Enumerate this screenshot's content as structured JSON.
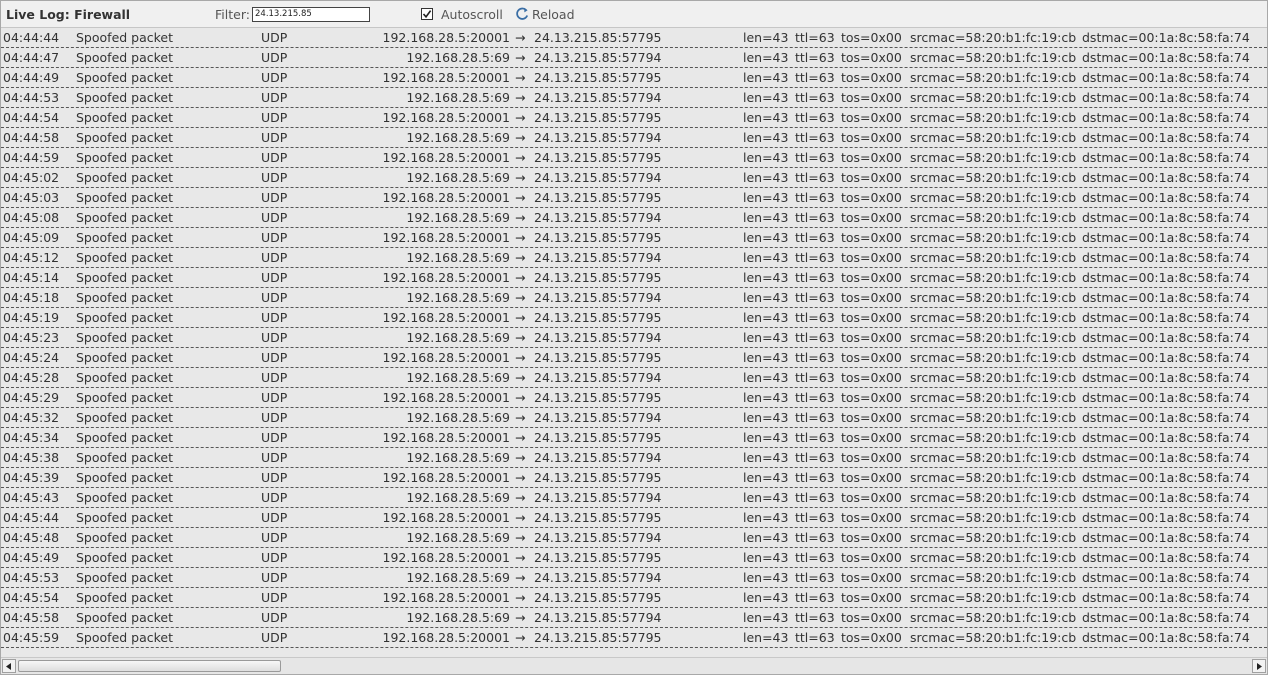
{
  "toolbar": {
    "title": "Live Log: Firewall",
    "filter_label": "Filter:",
    "filter_value": "24.13.215.85",
    "autoscroll_label": "Autoscroll",
    "autoscroll_checked": true,
    "reload_label": "Reload"
  },
  "colors": {
    "reload_icon": "#3a6ea5",
    "row_divider": "#555555"
  },
  "log": {
    "rows": [
      {
        "time": "04:44:44",
        "message": "Spoofed packet",
        "protocol": "UDP",
        "src": "192.168.28.5:20001",
        "arrow": "→",
        "dst": "24.13.215.85:57795",
        "len": "len=43",
        "ttl": "ttl=63",
        "tos": "tos=0x00",
        "srcmac": "srcmac=58:20:b1:fc:19:cb",
        "dstmac": "dstmac=00:1a:8c:58:fa:74"
      },
      {
        "time": "04:44:47",
        "message": "Spoofed packet",
        "protocol": "UDP",
        "src": "192.168.28.5:69",
        "arrow": "→",
        "dst": "24.13.215.85:57794",
        "len": "len=43",
        "ttl": "ttl=63",
        "tos": "tos=0x00",
        "srcmac": "srcmac=58:20:b1:fc:19:cb",
        "dstmac": "dstmac=00:1a:8c:58:fa:74"
      },
      {
        "time": "04:44:49",
        "message": "Spoofed packet",
        "protocol": "UDP",
        "src": "192.168.28.5:20001",
        "arrow": "→",
        "dst": "24.13.215.85:57795",
        "len": "len=43",
        "ttl": "ttl=63",
        "tos": "tos=0x00",
        "srcmac": "srcmac=58:20:b1:fc:19:cb",
        "dstmac": "dstmac=00:1a:8c:58:fa:74"
      },
      {
        "time": "04:44:53",
        "message": "Spoofed packet",
        "protocol": "UDP",
        "src": "192.168.28.5:69",
        "arrow": "→",
        "dst": "24.13.215.85:57794",
        "len": "len=43",
        "ttl": "ttl=63",
        "tos": "tos=0x00",
        "srcmac": "srcmac=58:20:b1:fc:19:cb",
        "dstmac": "dstmac=00:1a:8c:58:fa:74"
      },
      {
        "time": "04:44:54",
        "message": "Spoofed packet",
        "protocol": "UDP",
        "src": "192.168.28.5:20001",
        "arrow": "→",
        "dst": "24.13.215.85:57795",
        "len": "len=43",
        "ttl": "ttl=63",
        "tos": "tos=0x00",
        "srcmac": "srcmac=58:20:b1:fc:19:cb",
        "dstmac": "dstmac=00:1a:8c:58:fa:74"
      },
      {
        "time": "04:44:58",
        "message": "Spoofed packet",
        "protocol": "UDP",
        "src": "192.168.28.5:69",
        "arrow": "→",
        "dst": "24.13.215.85:57794",
        "len": "len=43",
        "ttl": "ttl=63",
        "tos": "tos=0x00",
        "srcmac": "srcmac=58:20:b1:fc:19:cb",
        "dstmac": "dstmac=00:1a:8c:58:fa:74"
      },
      {
        "time": "04:44:59",
        "message": "Spoofed packet",
        "protocol": "UDP",
        "src": "192.168.28.5:20001",
        "arrow": "→",
        "dst": "24.13.215.85:57795",
        "len": "len=43",
        "ttl": "ttl=63",
        "tos": "tos=0x00",
        "srcmac": "srcmac=58:20:b1:fc:19:cb",
        "dstmac": "dstmac=00:1a:8c:58:fa:74"
      },
      {
        "time": "04:45:02",
        "message": "Spoofed packet",
        "protocol": "UDP",
        "src": "192.168.28.5:69",
        "arrow": "→",
        "dst": "24.13.215.85:57794",
        "len": "len=43",
        "ttl": "ttl=63",
        "tos": "tos=0x00",
        "srcmac": "srcmac=58:20:b1:fc:19:cb",
        "dstmac": "dstmac=00:1a:8c:58:fa:74"
      },
      {
        "time": "04:45:03",
        "message": "Spoofed packet",
        "protocol": "UDP",
        "src": "192.168.28.5:20001",
        "arrow": "→",
        "dst": "24.13.215.85:57795",
        "len": "len=43",
        "ttl": "ttl=63",
        "tos": "tos=0x00",
        "srcmac": "srcmac=58:20:b1:fc:19:cb",
        "dstmac": "dstmac=00:1a:8c:58:fa:74"
      },
      {
        "time": "04:45:08",
        "message": "Spoofed packet",
        "protocol": "UDP",
        "src": "192.168.28.5:69",
        "arrow": "→",
        "dst": "24.13.215.85:57794",
        "len": "len=43",
        "ttl": "ttl=63",
        "tos": "tos=0x00",
        "srcmac": "srcmac=58:20:b1:fc:19:cb",
        "dstmac": "dstmac=00:1a:8c:58:fa:74"
      },
      {
        "time": "04:45:09",
        "message": "Spoofed packet",
        "protocol": "UDP",
        "src": "192.168.28.5:20001",
        "arrow": "→",
        "dst": "24.13.215.85:57795",
        "len": "len=43",
        "ttl": "ttl=63",
        "tos": "tos=0x00",
        "srcmac": "srcmac=58:20:b1:fc:19:cb",
        "dstmac": "dstmac=00:1a:8c:58:fa:74"
      },
      {
        "time": "04:45:12",
        "message": "Spoofed packet",
        "protocol": "UDP",
        "src": "192.168.28.5:69",
        "arrow": "→",
        "dst": "24.13.215.85:57794",
        "len": "len=43",
        "ttl": "ttl=63",
        "tos": "tos=0x00",
        "srcmac": "srcmac=58:20:b1:fc:19:cb",
        "dstmac": "dstmac=00:1a:8c:58:fa:74"
      },
      {
        "time": "04:45:14",
        "message": "Spoofed packet",
        "protocol": "UDP",
        "src": "192.168.28.5:20001",
        "arrow": "→",
        "dst": "24.13.215.85:57795",
        "len": "len=43",
        "ttl": "ttl=63",
        "tos": "tos=0x00",
        "srcmac": "srcmac=58:20:b1:fc:19:cb",
        "dstmac": "dstmac=00:1a:8c:58:fa:74"
      },
      {
        "time": "04:45:18",
        "message": "Spoofed packet",
        "protocol": "UDP",
        "src": "192.168.28.5:69",
        "arrow": "→",
        "dst": "24.13.215.85:57794",
        "len": "len=43",
        "ttl": "ttl=63",
        "tos": "tos=0x00",
        "srcmac": "srcmac=58:20:b1:fc:19:cb",
        "dstmac": "dstmac=00:1a:8c:58:fa:74"
      },
      {
        "time": "04:45:19",
        "message": "Spoofed packet",
        "protocol": "UDP",
        "src": "192.168.28.5:20001",
        "arrow": "→",
        "dst": "24.13.215.85:57795",
        "len": "len=43",
        "ttl": "ttl=63",
        "tos": "tos=0x00",
        "srcmac": "srcmac=58:20:b1:fc:19:cb",
        "dstmac": "dstmac=00:1a:8c:58:fa:74"
      },
      {
        "time": "04:45:23",
        "message": "Spoofed packet",
        "protocol": "UDP",
        "src": "192.168.28.5:69",
        "arrow": "→",
        "dst": "24.13.215.85:57794",
        "len": "len=43",
        "ttl": "ttl=63",
        "tos": "tos=0x00",
        "srcmac": "srcmac=58:20:b1:fc:19:cb",
        "dstmac": "dstmac=00:1a:8c:58:fa:74"
      },
      {
        "time": "04:45:24",
        "message": "Spoofed packet",
        "protocol": "UDP",
        "src": "192.168.28.5:20001",
        "arrow": "→",
        "dst": "24.13.215.85:57795",
        "len": "len=43",
        "ttl": "ttl=63",
        "tos": "tos=0x00",
        "srcmac": "srcmac=58:20:b1:fc:19:cb",
        "dstmac": "dstmac=00:1a:8c:58:fa:74"
      },
      {
        "time": "04:45:28",
        "message": "Spoofed packet",
        "protocol": "UDP",
        "src": "192.168.28.5:69",
        "arrow": "→",
        "dst": "24.13.215.85:57794",
        "len": "len=43",
        "ttl": "ttl=63",
        "tos": "tos=0x00",
        "srcmac": "srcmac=58:20:b1:fc:19:cb",
        "dstmac": "dstmac=00:1a:8c:58:fa:74"
      },
      {
        "time": "04:45:29",
        "message": "Spoofed packet",
        "protocol": "UDP",
        "src": "192.168.28.5:20001",
        "arrow": "→",
        "dst": "24.13.215.85:57795",
        "len": "len=43",
        "ttl": "ttl=63",
        "tos": "tos=0x00",
        "srcmac": "srcmac=58:20:b1:fc:19:cb",
        "dstmac": "dstmac=00:1a:8c:58:fa:74"
      },
      {
        "time": "04:45:32",
        "message": "Spoofed packet",
        "protocol": "UDP",
        "src": "192.168.28.5:69",
        "arrow": "→",
        "dst": "24.13.215.85:57794",
        "len": "len=43",
        "ttl": "ttl=63",
        "tos": "tos=0x00",
        "srcmac": "srcmac=58:20:b1:fc:19:cb",
        "dstmac": "dstmac=00:1a:8c:58:fa:74"
      },
      {
        "time": "04:45:34",
        "message": "Spoofed packet",
        "protocol": "UDP",
        "src": "192.168.28.5:20001",
        "arrow": "→",
        "dst": "24.13.215.85:57795",
        "len": "len=43",
        "ttl": "ttl=63",
        "tos": "tos=0x00",
        "srcmac": "srcmac=58:20:b1:fc:19:cb",
        "dstmac": "dstmac=00:1a:8c:58:fa:74"
      },
      {
        "time": "04:45:38",
        "message": "Spoofed packet",
        "protocol": "UDP",
        "src": "192.168.28.5:69",
        "arrow": "→",
        "dst": "24.13.215.85:57794",
        "len": "len=43",
        "ttl": "ttl=63",
        "tos": "tos=0x00",
        "srcmac": "srcmac=58:20:b1:fc:19:cb",
        "dstmac": "dstmac=00:1a:8c:58:fa:74"
      },
      {
        "time": "04:45:39",
        "message": "Spoofed packet",
        "protocol": "UDP",
        "src": "192.168.28.5:20001",
        "arrow": "→",
        "dst": "24.13.215.85:57795",
        "len": "len=43",
        "ttl": "ttl=63",
        "tos": "tos=0x00",
        "srcmac": "srcmac=58:20:b1:fc:19:cb",
        "dstmac": "dstmac=00:1a:8c:58:fa:74"
      },
      {
        "time": "04:45:43",
        "message": "Spoofed packet",
        "protocol": "UDP",
        "src": "192.168.28.5:69",
        "arrow": "→",
        "dst": "24.13.215.85:57794",
        "len": "len=43",
        "ttl": "ttl=63",
        "tos": "tos=0x00",
        "srcmac": "srcmac=58:20:b1:fc:19:cb",
        "dstmac": "dstmac=00:1a:8c:58:fa:74"
      },
      {
        "time": "04:45:44",
        "message": "Spoofed packet",
        "protocol": "UDP",
        "src": "192.168.28.5:20001",
        "arrow": "→",
        "dst": "24.13.215.85:57795",
        "len": "len=43",
        "ttl": "ttl=63",
        "tos": "tos=0x00",
        "srcmac": "srcmac=58:20:b1:fc:19:cb",
        "dstmac": "dstmac=00:1a:8c:58:fa:74"
      },
      {
        "time": "04:45:48",
        "message": "Spoofed packet",
        "protocol": "UDP",
        "src": "192.168.28.5:69",
        "arrow": "→",
        "dst": "24.13.215.85:57794",
        "len": "len=43",
        "ttl": "ttl=63",
        "tos": "tos=0x00",
        "srcmac": "srcmac=58:20:b1:fc:19:cb",
        "dstmac": "dstmac=00:1a:8c:58:fa:74"
      },
      {
        "time": "04:45:49",
        "message": "Spoofed packet",
        "protocol": "UDP",
        "src": "192.168.28.5:20001",
        "arrow": "→",
        "dst": "24.13.215.85:57795",
        "len": "len=43",
        "ttl": "ttl=63",
        "tos": "tos=0x00",
        "srcmac": "srcmac=58:20:b1:fc:19:cb",
        "dstmac": "dstmac=00:1a:8c:58:fa:74"
      },
      {
        "time": "04:45:53",
        "message": "Spoofed packet",
        "protocol": "UDP",
        "src": "192.168.28.5:69",
        "arrow": "→",
        "dst": "24.13.215.85:57794",
        "len": "len=43",
        "ttl": "ttl=63",
        "tos": "tos=0x00",
        "srcmac": "srcmac=58:20:b1:fc:19:cb",
        "dstmac": "dstmac=00:1a:8c:58:fa:74"
      },
      {
        "time": "04:45:54",
        "message": "Spoofed packet",
        "protocol": "UDP",
        "src": "192.168.28.5:20001",
        "arrow": "→",
        "dst": "24.13.215.85:57795",
        "len": "len=43",
        "ttl": "ttl=63",
        "tos": "tos=0x00",
        "srcmac": "srcmac=58:20:b1:fc:19:cb",
        "dstmac": "dstmac=00:1a:8c:58:fa:74"
      },
      {
        "time": "04:45:58",
        "message": "Spoofed packet",
        "protocol": "UDP",
        "src": "192.168.28.5:69",
        "arrow": "→",
        "dst": "24.13.215.85:57794",
        "len": "len=43",
        "ttl": "ttl=63",
        "tos": "tos=0x00",
        "srcmac": "srcmac=58:20:b1:fc:19:cb",
        "dstmac": "dstmac=00:1a:8c:58:fa:74"
      },
      {
        "time": "04:45:59",
        "message": "Spoofed packet",
        "protocol": "UDP",
        "src": "192.168.28.5:20001",
        "arrow": "→",
        "dst": "24.13.215.85:57795",
        "len": "len=43",
        "ttl": "ttl=63",
        "tos": "tos=0x00",
        "srcmac": "srcmac=58:20:b1:fc:19:cb",
        "dstmac": "dstmac=00:1a:8c:58:fa:74"
      }
    ]
  },
  "scrollbar": {
    "left_icon": "triangle-left-icon",
    "right_icon": "triangle-right-icon"
  }
}
